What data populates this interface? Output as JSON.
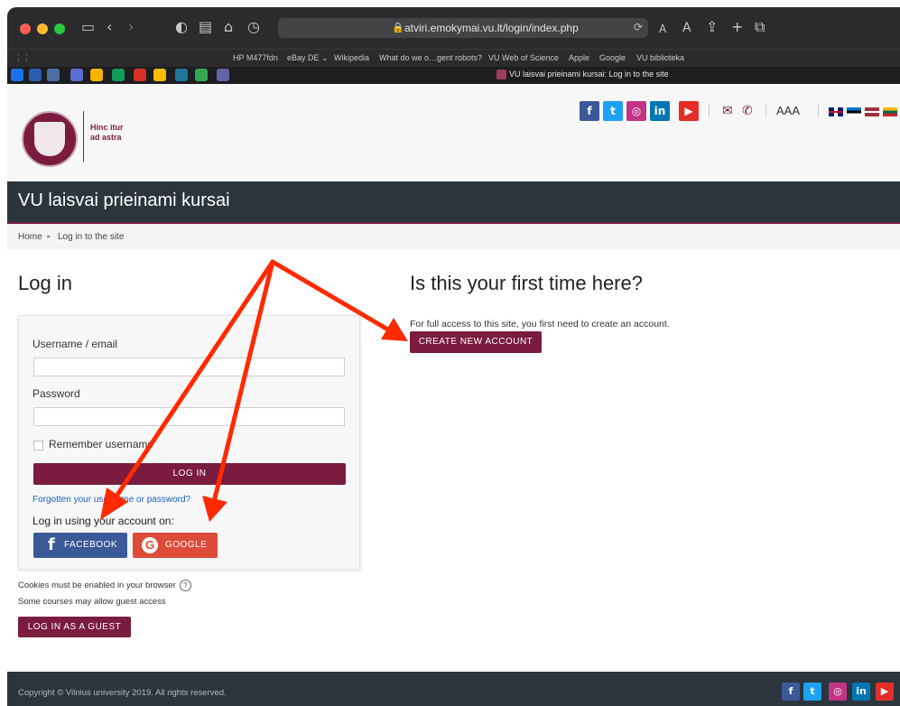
{
  "browser": {
    "url": "atviri.emokymai.vu.lt/login/index.php",
    "tab_title": "VU laisvai prieinami kursai: Log in to the site",
    "text_size_small": "A",
    "text_size_large": "A",
    "favorites": [
      "HP M477fdn",
      "eBay DE ⌄",
      "Wikipedia",
      "What do we o…gent robots?",
      "VU Web of Science",
      "Apple",
      "Google",
      "VU biblioteka"
    ]
  },
  "header": {
    "logo_text_line1": "Hinc itur",
    "logo_text_line2": "ad astra",
    "social": [
      {
        "name": "facebook",
        "glyph": "f",
        "color": "#3b5998"
      },
      {
        "name": "twitter",
        "glyph": "t",
        "color": "#1da1f2"
      },
      {
        "name": "instagram",
        "glyph": "◎",
        "color": "#c13584"
      },
      {
        "name": "linkedin",
        "glyph": "in",
        "color": "#0077b5"
      },
      {
        "name": "youtube",
        "glyph": "▶",
        "color": "#e52d27"
      }
    ],
    "font_sizes": "AAA",
    "site_title": "VU laisvai prieinami kursai"
  },
  "breadcrumb": {
    "home": "Home",
    "separator": "►",
    "current": "Log in to the site"
  },
  "login": {
    "heading": "Log in",
    "username_label": "Username / email",
    "username_value": "",
    "password_label": "Password",
    "password_value": "",
    "remember_label": "Remember username",
    "login_button": "LOG IN",
    "forgot_link": "Forgotten your username or password?",
    "login_using": "Log in using your account on:",
    "facebook_button": "FACEBOOK",
    "google_button": "GOOGLE",
    "cookies_note": "Cookies must be enabled in your browser",
    "guest_note": "Some courses may allow guest access",
    "guest_button": "LOG IN AS A GUEST"
  },
  "signup": {
    "heading": "Is this your first time here?",
    "text": "For full access to this site, you first need to create an account.",
    "create_button": "CREATE NEW ACCOUNT"
  },
  "footer": {
    "copyright": "Copyright © Vilnius university 2019. All rights reserved."
  },
  "annotation": {
    "arrow_color": "#ff2a00"
  }
}
